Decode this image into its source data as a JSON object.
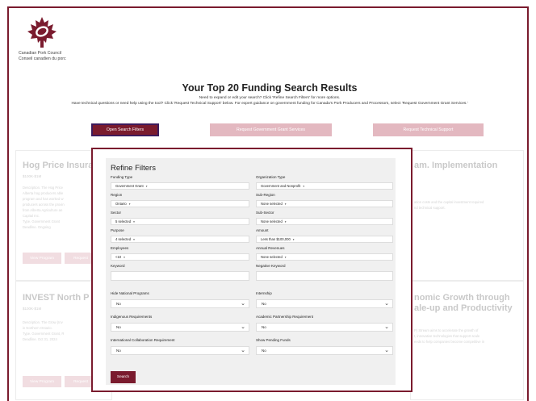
{
  "brand": {
    "org_en": "Canadian Pork Council",
    "org_fr": "Conseil canadien du porc",
    "color": "#7a1b2e"
  },
  "header": {
    "title": "Your Top 20 Funding Search Results",
    "subtitle": "Need to expand or edit your search? Click 'Refine Search Filters' for more options.",
    "help_text": "Have technical questions or need help using the tool? Click 'Request Technical Support' below. For expert guidance on government funding for Canada's Pork Producers and Processors, select 'Request Government Grant Services.'"
  },
  "actions": {
    "open_filters": "Open Search Filters",
    "grant_services": "Request Government Grant Services",
    "tech_support": "Request Technical Support"
  },
  "cards": [
    {
      "title": "Hog Price Insura",
      "amount": "$100K-$1M",
      "lines": [
        "Description. The Hog Price",
        "Alberta hog producers able",
        "program and has worked w",
        "producers across the provin",
        "from Alberta Agriculture an",
        "Capital Inc."
      ],
      "type": "Type. Government Grant",
      "deadline": "Deadline. Ongoing",
      "view": "View Program",
      "request": "Request"
    },
    {
      "title": "am. Implementation",
      "lines": [
        "ation costs and the capital investment required",
        "nd technical support."
      ]
    },
    {
      "title": "INVEST North P",
      "amount": "$100K-$1M",
      "lines": [
        "Description. The Grow (Inv",
        "in Northern Ontario."
      ],
      "type": "Type. Government Grant, R",
      "deadline": "Deadline. Oct 31, 2024",
      "view": "View Program",
      "request": "Request"
    },
    {
      "title": "nomic Growth through",
      "title2": "ale-up and Productivity",
      "lines": [
        "P) Stream aims to accelerate the growth of",
        "t, innovative technologies that support scale",
        "eeds to help companies become competitive in"
      ]
    }
  ],
  "filters": {
    "heading": "Refine Filters",
    "funding_type": {
      "label": "Funding Type",
      "value": "Government Grant"
    },
    "organization_type": {
      "label": "Organization Type",
      "value": "Government and Nonprofit"
    },
    "region": {
      "label": "Region",
      "value": "Ontario"
    },
    "sub_region": {
      "label": "Sub-Region",
      "value": "None selected"
    },
    "sector": {
      "label": "Sector",
      "value": "5 selected"
    },
    "sub_sector": {
      "label": "Sub-Sector",
      "value": "None selected"
    },
    "purpose": {
      "label": "Purpose",
      "value": "4 selected"
    },
    "amount": {
      "label": "Amount",
      "value": "Less than $100,000"
    },
    "employees": {
      "label": "Employees",
      "value": "<10"
    },
    "annual_revenues": {
      "label": "Annual Revenues",
      "value": "None selected"
    },
    "keyword": {
      "label": "Keyword",
      "value": ""
    },
    "negative_keyword": {
      "label": "Negative Keyword",
      "value": ""
    },
    "hide_national": {
      "label": "Hide National Programs",
      "value": "No"
    },
    "internship": {
      "label": "Internship",
      "value": "No"
    },
    "indigenous": {
      "label": "Indigenous Requirements",
      "value": "No"
    },
    "academic": {
      "label": "Academic Partnership Requirement",
      "value": "No"
    },
    "international": {
      "label": "International Collaboration Requirement",
      "value": "No"
    },
    "pending_funds": {
      "label": "Show Pending Funds",
      "value": "No"
    },
    "search": "Search"
  }
}
